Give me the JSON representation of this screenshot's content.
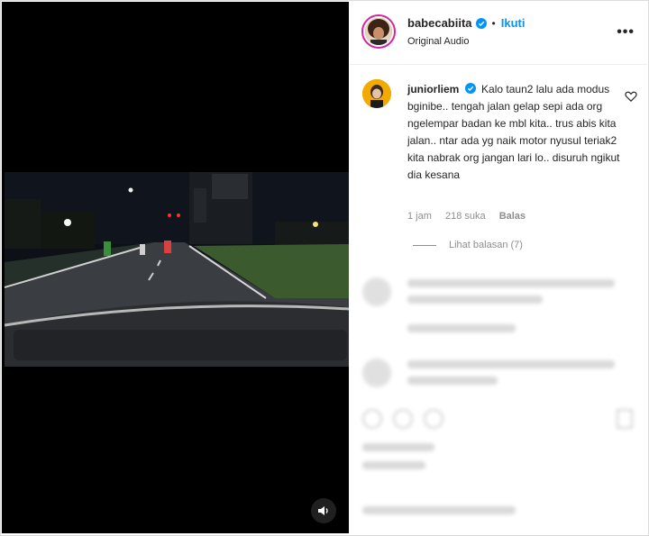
{
  "post": {
    "author": {
      "username": "babecabiita",
      "verified": true,
      "follow_label": "Ikuti",
      "separator": "•"
    },
    "audio_label": "Original Audio",
    "more_label": "•••"
  },
  "comment": {
    "username": "juniorliem",
    "verified": true,
    "text": "Kalo taun2 lalu ada modus bginibe.. tengah jalan gelap sepi ada org ngelempar badan ke mbl kita.. trus abis kita jalan.. ntar ada yg naik motor nyusul teriak2 kita nabrak org jangan lari lo.. disuruh ngikut dia kesana",
    "time": "1 jam",
    "likes": "218 suka",
    "reply_label": "Balas",
    "view_replies_label": "Lihat balasan (7)"
  },
  "icons": {
    "verified": "verified-badge-icon",
    "more": "more-options-icon",
    "like": "heart-icon",
    "mute": "speaker-icon"
  },
  "colors": {
    "accent": "#0095f6",
    "verified": "#0095f6",
    "muted_text": "#8e8e8e",
    "video_bg": "#000000"
  }
}
